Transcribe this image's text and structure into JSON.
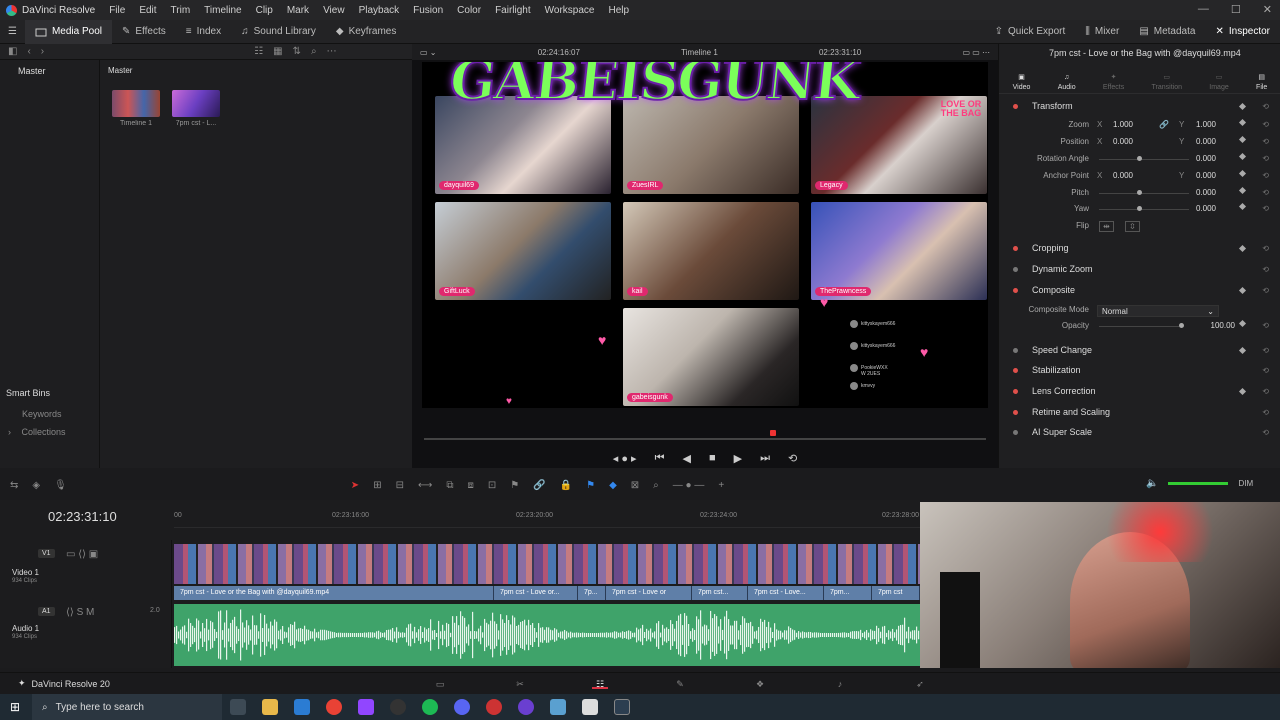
{
  "window": {
    "app_name": "DaVinci Resolve",
    "menu": [
      "File",
      "Edit",
      "Trim",
      "Timeline",
      "Clip",
      "Mark",
      "View",
      "Playback",
      "Fusion",
      "Color",
      "Fairlight",
      "Workspace",
      "Help"
    ]
  },
  "toolbar": {
    "left": [
      "Media Pool",
      "Effects",
      "Index",
      "Sound Library",
      "Keyframes"
    ],
    "right": [
      "Quick Export",
      "Mixer",
      "Metadata",
      "Inspector"
    ]
  },
  "media_pool": {
    "bin_header": "Master",
    "bin_path": "Master",
    "clips": [
      "Timeline 1",
      "7pm cst - L..."
    ],
    "smart_bins": "Smart Bins",
    "keywords": "Keywords",
    "collections": "Collections"
  },
  "viewer": {
    "timecode_left": "02:24:16:07",
    "timeline_name": "Timeline 1",
    "timecode_right": "02:23:31:10",
    "overlay_title": "GABEISGUNK",
    "cams": [
      "dayquil69",
      "ZuesIRL",
      "Legacy",
      "GiftLuck",
      "kail",
      "ThePrawncess",
      "gabeisgunk"
    ],
    "love_logo": "LOVE OR THE BAG",
    "chat": [
      "kittyskayem666",
      "kittyskayem666",
      "PookieWXX",
      "W 2UES",
      "kmvvy"
    ]
  },
  "inspector": {
    "clip_title": "7pm cst - Love or the Bag with @dayquil69.mp4",
    "tabs": [
      "Video",
      "Audio",
      "Effects",
      "Transition",
      "Image",
      "File"
    ],
    "transform": "Transform",
    "zoom": {
      "label": "Zoom",
      "x": "1.000",
      "y": "1.000"
    },
    "position": {
      "label": "Position",
      "x": "0.000",
      "y": "0.000"
    },
    "rotation": {
      "label": "Rotation Angle",
      "v": "0.000"
    },
    "anchor": {
      "label": "Anchor Point",
      "x": "0.000",
      "y": "0.000"
    },
    "pitch": {
      "label": "Pitch",
      "v": "0.000"
    },
    "yaw": {
      "label": "Yaw",
      "v": "0.000"
    },
    "flip": {
      "label": "Flip"
    },
    "sections": [
      "Cropping",
      "Dynamic Zoom",
      "Composite"
    ],
    "composite_mode": {
      "label": "Composite Mode",
      "v": "Normal"
    },
    "opacity": {
      "label": "Opacity",
      "v": "100.00"
    },
    "sections2": [
      "Speed Change",
      "Stabilization",
      "Lens Correction",
      "Retime and Scaling",
      "AI Super Scale"
    ],
    "x": "X",
    "y": "Y"
  },
  "timeline": {
    "timecode": "02:23:31:10",
    "ruler": [
      "00",
      "02:23:16:00",
      "02:23:20:00",
      "02:23:24:00",
      "02:23:28:00"
    ],
    "video_track": {
      "id": "V1",
      "name": "Video 1",
      "clips": "934 Clips"
    },
    "audio_track": {
      "id": "A1",
      "name": "Audio 1",
      "clips": "934 Clips",
      "level": "2.0"
    },
    "clip_labels": [
      "7pm cst - Love or the Bag with @dayquil69.mp4",
      "7pm cst - Love or...",
      "7p...",
      "7pm cst - Love or",
      "7pm cst...",
      "7pm cst - Love...",
      "7pm...",
      "7pm cst"
    ],
    "dim": "DIM"
  },
  "pagebar": {
    "name": "DaVinci Resolve 20"
  },
  "taskbar": {
    "search_placeholder": "Type here to search"
  },
  "colors": {
    "accent": "#e0286e",
    "watermark": "#7bff5a",
    "audio": "#3fa36a",
    "video_label": "#5f7fa8"
  }
}
